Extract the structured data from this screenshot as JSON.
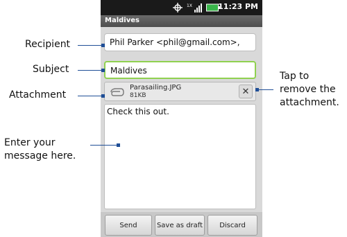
{
  "statusbar": {
    "time": "11:23 PM",
    "icons": [
      "gps-icon",
      "data-signal-icon",
      "battery-icon"
    ]
  },
  "titlebar": {
    "title": "Maldives"
  },
  "compose": {
    "recipient": "Phil Parker <phil@gmail.com>,",
    "subject": "Maldives",
    "attachment": {
      "name": "Parasailing.JPG",
      "size": "81KB"
    },
    "body": "Check this out."
  },
  "buttons": {
    "send": "Send",
    "save_draft": "Save as draft",
    "discard": "Discard"
  },
  "callouts": {
    "recipient": "Recipient",
    "subject": "Subject",
    "attachment": "Attachment",
    "message_line1": "Enter your",
    "message_line2": "message here.",
    "remove_line1": "Tap to",
    "remove_line2": "remove the",
    "remove_line3": "attachment."
  },
  "colors": {
    "callout_line": "#1f4e96",
    "subject_focus": "#8fd14f",
    "status_bar": "#1a1a1a",
    "title_bar": "#555555"
  }
}
